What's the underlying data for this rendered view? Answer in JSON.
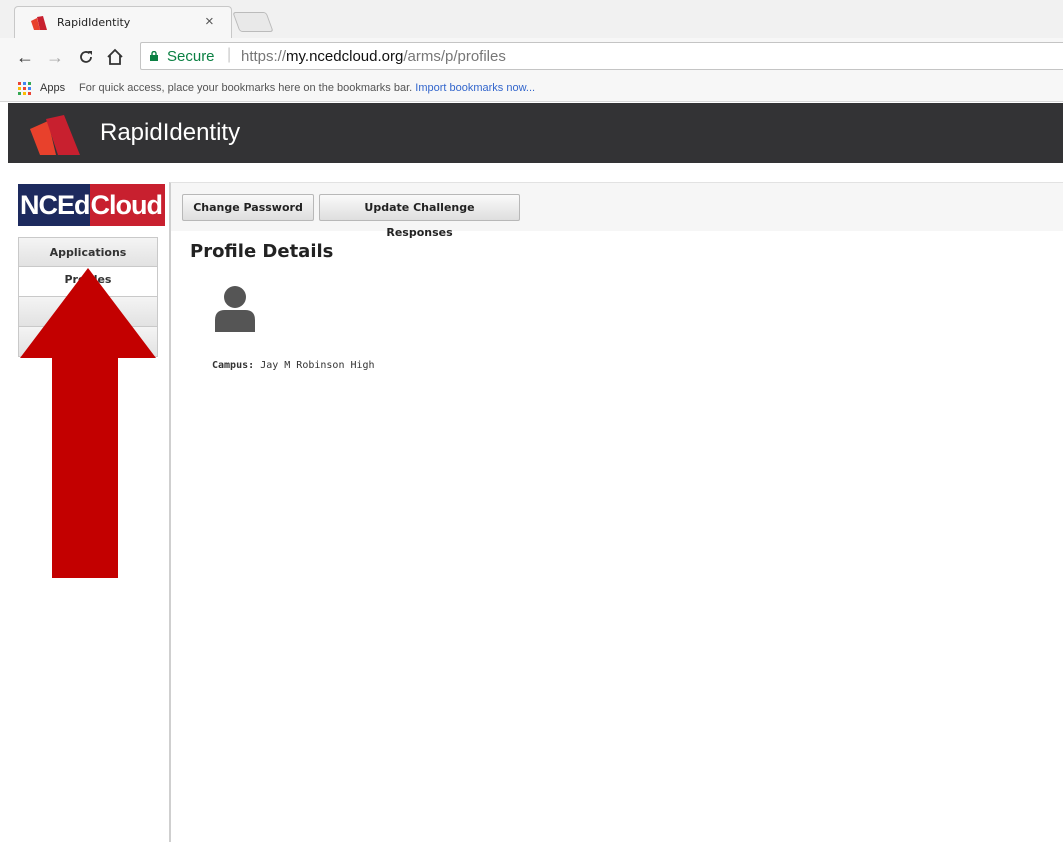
{
  "browser": {
    "tab_title": "RapidIdentity",
    "tab_close": "×",
    "secure_label": "Secure",
    "url_scheme": "https://",
    "url_host": "my.ncedcloud.org",
    "url_path": "/arms/p/profiles",
    "bookmarks": {
      "apps_label": "Apps",
      "hint": "For quick access, place your bookmarks here on the bookmarks bar.",
      "import_link": "Import bookmarks now..."
    }
  },
  "app": {
    "title": "RapidIdentity",
    "brand_color": "#e8412c",
    "header_bg": "#333335"
  },
  "sidebar": {
    "logo_left": "NCEd",
    "logo_right": "Cloud",
    "items": [
      {
        "label": "Applications"
      },
      {
        "label": "Profiles"
      },
      {
        "label": ""
      },
      {
        "label": ""
      }
    ]
  },
  "main": {
    "buttons": {
      "change_password": "Change Password",
      "update_challenge": "Update Challenge Responses"
    },
    "page_title": "Profile Details",
    "campus_label": "Campus:",
    "campus_value": "Jay M Robinson High"
  },
  "annotation": {
    "arrow_color": "#c30000"
  }
}
